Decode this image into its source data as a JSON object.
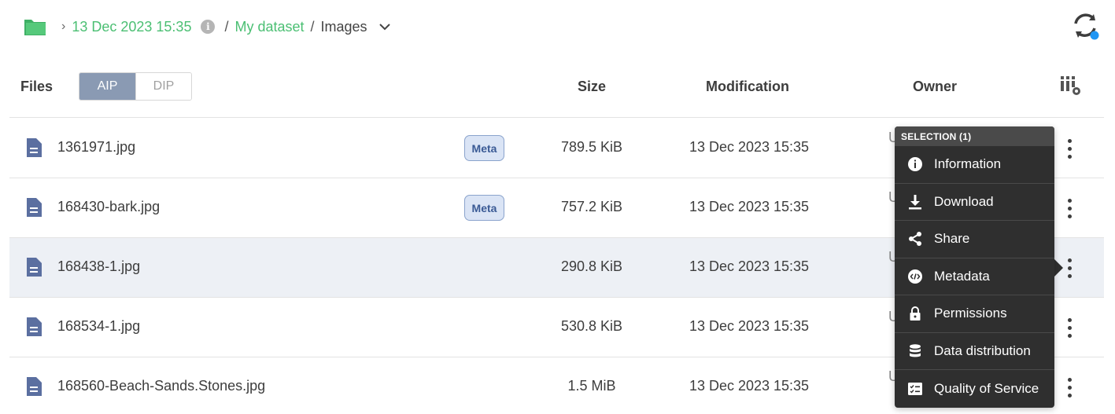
{
  "breadcrumb": {
    "items": [
      {
        "label": "13 Dec 2023 15:35"
      },
      {
        "label": "My dataset"
      },
      {
        "label": "Images"
      }
    ],
    "info_icon": "i",
    "colors": {
      "link": "#4bbf73",
      "folder": "#4bbf73"
    }
  },
  "header": {
    "files_label": "Files",
    "tabs": [
      {
        "label": "AIP",
        "active": true
      },
      {
        "label": "DIP",
        "active": false
      }
    ],
    "columns": [
      "Size",
      "Modification",
      "Owner"
    ]
  },
  "files": [
    {
      "name": "1361971.jpg",
      "meta": "Meta",
      "size": "789.5 KiB",
      "modified": "13 Dec 2023 15:35",
      "owner": "U",
      "selected": false
    },
    {
      "name": "168430-bark.jpg",
      "meta": "Meta",
      "size": "757.2 KiB",
      "modified": "13 Dec 2023 15:35",
      "owner": "U",
      "selected": false
    },
    {
      "name": "168438-1.jpg",
      "meta": "",
      "size": "290.8 KiB",
      "modified": "13 Dec 2023 15:35",
      "owner": "U",
      "selected": true
    },
    {
      "name": "168534-1.jpg",
      "meta": "",
      "size": "530.8 KiB",
      "modified": "13 Dec 2023 15:35",
      "owner": "U",
      "selected": false
    },
    {
      "name": "168560-Beach-Sands.Stones.jpg",
      "meta": "",
      "size": "1.5 MiB",
      "modified": "13 Dec 2023 15:35",
      "owner": "U",
      "selected": false
    }
  ],
  "context_menu": {
    "header": "SELECTION (1)",
    "items": [
      {
        "label": "Information",
        "icon": "info-icon"
      },
      {
        "label": "Download",
        "icon": "download-icon"
      },
      {
        "label": "Share",
        "icon": "share-icon"
      },
      {
        "label": "Metadata",
        "icon": "code-icon"
      },
      {
        "label": "Permissions",
        "icon": "lock-icon"
      },
      {
        "label": "Data distribution",
        "icon": "database-icon"
      },
      {
        "label": "Quality of Service",
        "icon": "checklist-icon"
      }
    ]
  },
  "colors": {
    "tab_active_bg": "#8a9ab3",
    "selected_row_bg": "#edf0f5",
    "meta_badge_bg": "#dae4f5",
    "file_icon": "#5b6fa0",
    "menu_bg": "#2f2f2f",
    "sync_dot": "#2196f3"
  }
}
